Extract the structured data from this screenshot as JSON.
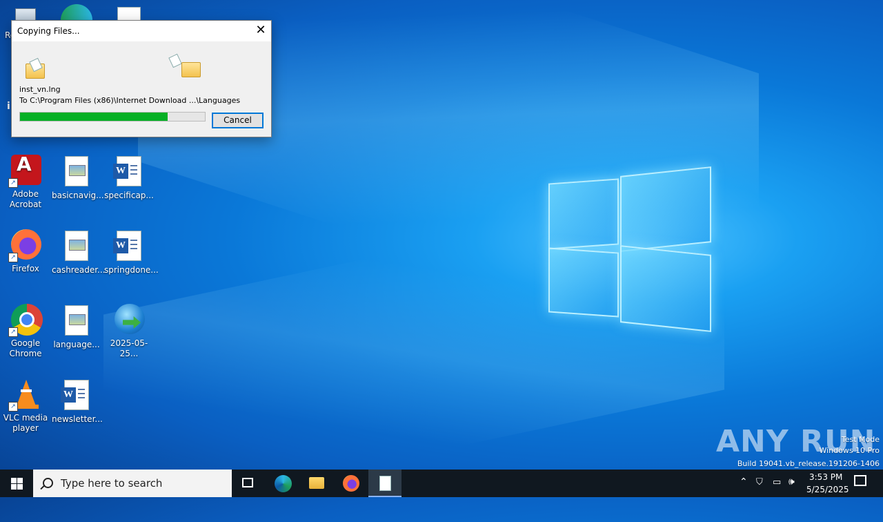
{
  "desktop": {
    "icons": [
      {
        "label": "Re",
        "type": "recycle"
      },
      {
        "label": "Adobe Acrobat",
        "type": "acrobat"
      },
      {
        "label": "basicnavig...",
        "type": "image-doc"
      },
      {
        "label": "specificap...",
        "type": "word"
      },
      {
        "label": "Firefox",
        "type": "firefox"
      },
      {
        "label": "cashreader...",
        "type": "image-doc"
      },
      {
        "label": "springdone...",
        "type": "word"
      },
      {
        "label": "Google Chrome",
        "type": "chrome"
      },
      {
        "label": "language...",
        "type": "image-doc"
      },
      {
        "label": "2025-05-25...",
        "type": "idm"
      },
      {
        "label": "VLC media player",
        "type": "vlc"
      },
      {
        "label": "newsletter...",
        "type": "word"
      }
    ]
  },
  "dialog": {
    "title": "Copying Files...",
    "filename": "inst_vn.lng",
    "destination": "To C:\\Program Files (x86)\\Internet Download ...\\Languages",
    "progress_percent": 80,
    "cancel_label": "Cancel",
    "close_glyph": "✕"
  },
  "taskbar": {
    "search_placeholder": "Type here to search",
    "time": "3:53 PM",
    "date": "5/25/2025"
  },
  "watermark": {
    "line1": "Test Mode",
    "line2": "Windows 10 Pro",
    "line3": "Build 19041.vb_release.191206-1406",
    "brand": "ANY RUN"
  },
  "colors": {
    "progress_fill": "#06b025",
    "taskbar": "#101820",
    "accent": "#0078d7"
  }
}
